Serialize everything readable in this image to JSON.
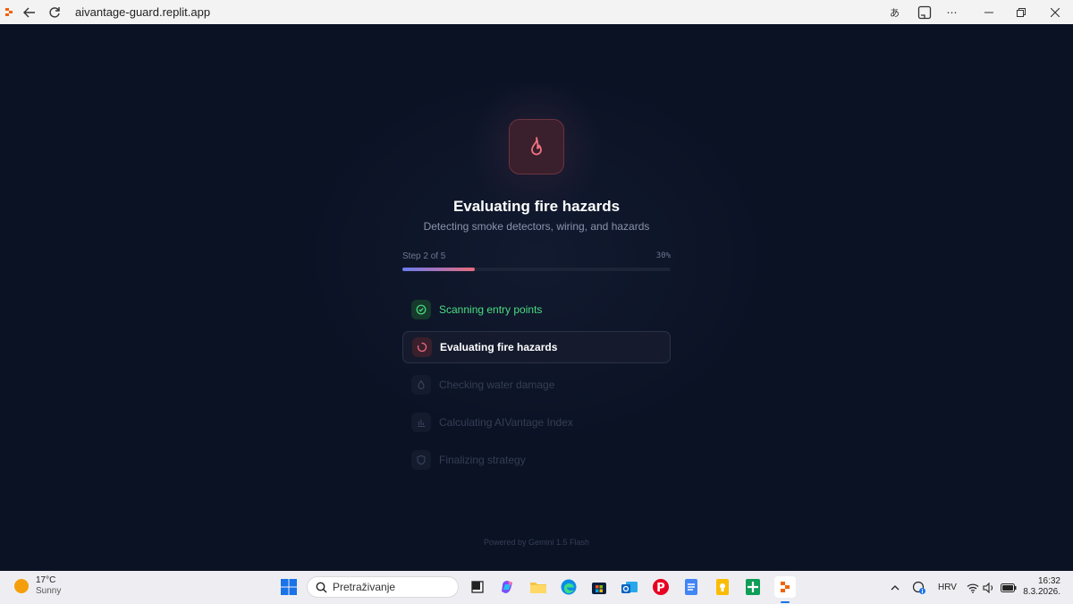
{
  "browser": {
    "url": "aivantage-guard.replit.app"
  },
  "main": {
    "title": "Evaluating fire hazards",
    "subtitle": "Detecting smoke detectors, wiring, and hazards",
    "step_label": "Step 2 of 5",
    "progress_percent_label": "30%",
    "progress": 0.27,
    "steps": [
      {
        "label": "Scanning entry points",
        "state": "done",
        "icon": "check-circle-icon"
      },
      {
        "label": "Evaluating fire hazards",
        "state": "active",
        "icon": "spinner-icon"
      },
      {
        "label": "Checking water damage",
        "state": "pending",
        "icon": "water-drop-icon"
      },
      {
        "label": "Calculating AIVantage Index",
        "state": "pending",
        "icon": "bar-chart-icon"
      },
      {
        "label": "Finalizing strategy",
        "state": "pending",
        "icon": "shield-icon"
      }
    ],
    "powered_by": "Powered by Gemini 1.5 Flash"
  },
  "colors": {
    "background": "#0b1224",
    "accent_fire": "#e86b7e",
    "success": "#4ade80",
    "progress_start": "#6b7cf0"
  },
  "taskbar": {
    "weather_temp": "17°C",
    "weather_cond": "Sunny",
    "search_placeholder": "Pretraživanje",
    "language": "HRV",
    "time": "16:32",
    "date": "8.3.2026."
  }
}
